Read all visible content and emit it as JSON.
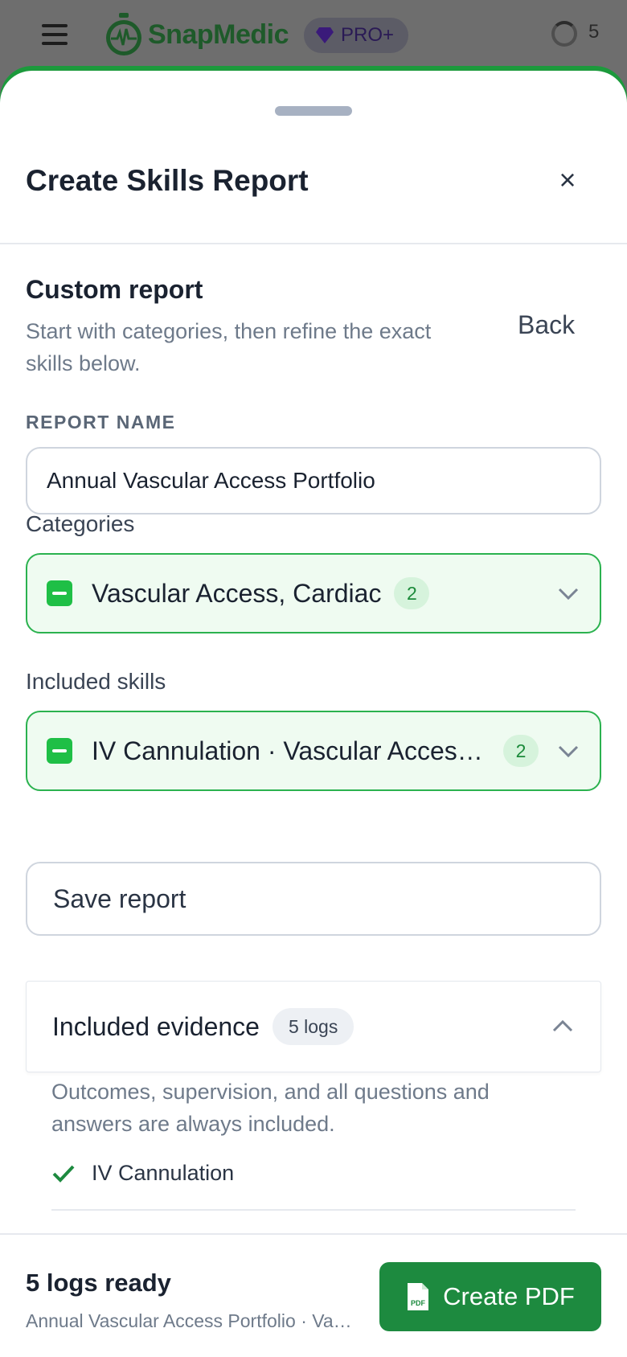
{
  "appbar": {
    "brand": "SnapMedic",
    "badge": "PRO+",
    "count": "5"
  },
  "sheet": {
    "title": "Create Skills Report",
    "close_label": "×",
    "subtitle": "Custom report",
    "description": "Start with categories, then refine the exact skills below.",
    "back_label": "Back",
    "report_name_label": "REPORT NAME",
    "report_name_value": "Annual Vascular Access Portfolio",
    "categories": {
      "label": "Categories",
      "value": "Vascular Access, Cardiac",
      "count": "2"
    },
    "skills": {
      "label": "Included skills",
      "value": "IV Cannulation · Vascular Access, ECG",
      "count": "2"
    },
    "save_label": "Save report",
    "evidence": {
      "title": "Included evidence",
      "count_label": "5 logs",
      "note": "Outcomes, supervision, and all questions and answers are always included.",
      "items": [
        "IV Cannulation"
      ]
    }
  },
  "footer": {
    "ready_title": "5 logs ready",
    "ready_subtitle": "Annual Vascular Access Portfolio · Vascular Access, Cardiac",
    "create_label": "Create PDF"
  },
  "colors": {
    "brand_green": "#1d8a3f",
    "accent_green": "#2bb24f",
    "selected_bg": "#effbf1"
  }
}
